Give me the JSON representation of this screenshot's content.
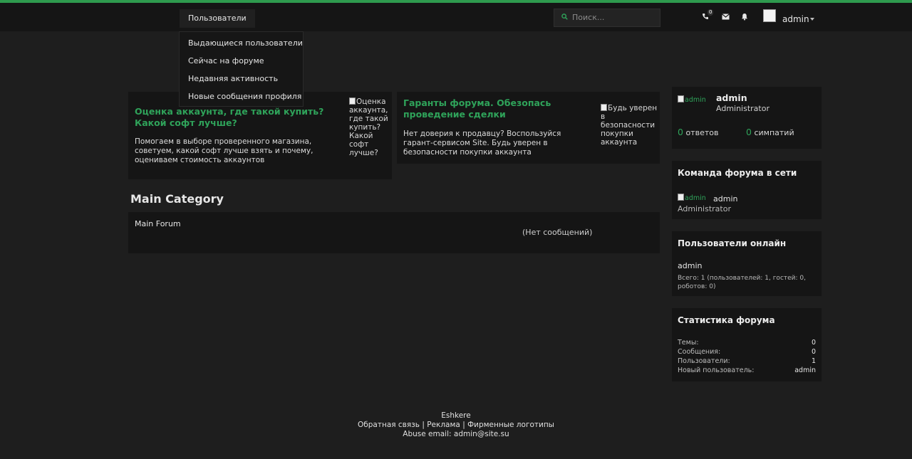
{
  "nav": {
    "users_label": "Пользователи",
    "search_placeholder": "Поиск...",
    "username": "admin",
    "notif_badge": "0"
  },
  "users_menu": {
    "items": [
      "Выдающиеся пользователи",
      "Сейчас на форуме",
      "Недавняя активность",
      "Новые сообщения профиля"
    ]
  },
  "promo": [
    {
      "title": "Оценка аккаунта, где такой купить? Какой софт лучше?",
      "text": "Помогаем в выборе проверенного магазина, советуем, какой софт лучше взять и почему, оцениваем стоимость аккаунтов",
      "img_alt": "Оценка аккаунта, где такой купить? Какой софт лучше?"
    },
    {
      "title": "Гаранты форума. Обезопась проведение сделки",
      "text": "Нет доверия к продавцу? Воспользуйся гарант-сервисом Site. Будь уверен в безопасности покупки аккаунта",
      "img_alt": "Будь уверен в безопасности покупки аккаунта"
    }
  ],
  "category": {
    "title": "Main Category",
    "forum_name": "Main Forum",
    "empty_text": "(Нет сообщений)"
  },
  "profile": {
    "avatar_alt": "admin",
    "name": "admin",
    "role": "Administrator",
    "replies_count": "0",
    "replies_label": "ответов",
    "likes_count": "0",
    "likes_label": "симпатий"
  },
  "staff": {
    "title": "Команда форума в сети",
    "avatar_alt": "admin",
    "name": "admin",
    "role": "Administrator"
  },
  "online": {
    "title": "Пользователи онлайн",
    "user": "admin",
    "summary": "Всего: 1 (пользователей: 1, гостей: 0, роботов: 0)"
  },
  "stats": {
    "title": "Статистика форума",
    "rows": [
      {
        "label": "Темы:",
        "value": "0"
      },
      {
        "label": "Сообщения:",
        "value": "0"
      },
      {
        "label": "Пользователи:",
        "value": "1"
      },
      {
        "label": "Новый пользователь:",
        "value": "admin"
      }
    ]
  },
  "footer": {
    "site_name": "Eshkere",
    "links": [
      "Обратная связь",
      "Реклама",
      "Фирменные логотипы"
    ],
    "separator": "|",
    "abuse": "Abuse email: admin@site.su"
  },
  "colors": {
    "accent": "#2fa35a",
    "background": "#1e1e1e",
    "panel": "#151515"
  }
}
